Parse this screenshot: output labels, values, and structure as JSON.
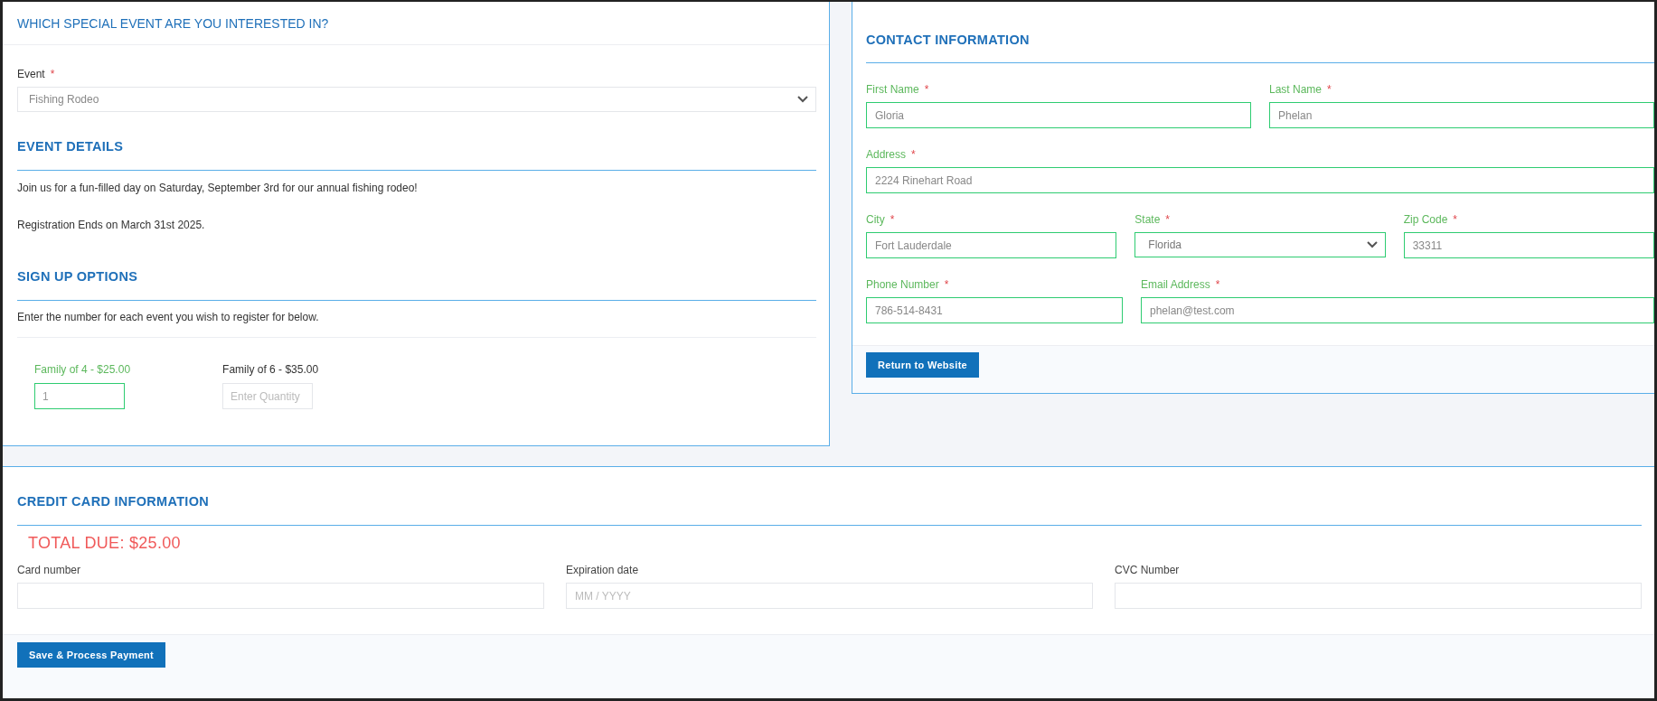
{
  "event_section": {
    "title": "WHICH SPECIAL EVENT ARE YOU INTERESTED IN?",
    "event_field": {
      "label": "Event",
      "required_mark": "*",
      "value": "Fishing Rodeo"
    }
  },
  "event_details": {
    "title": "EVENT DETAILS",
    "paragraphs": [
      "Join us for a fun-filled day on Saturday, September 3rd for our annual fishing rodeo!",
      "Registration Ends on March 31st 2025."
    ]
  },
  "signup_options": {
    "title": "SIGN UP OPTIONS",
    "instruction": "Enter the number for each event you wish to register for below.",
    "options": [
      {
        "label": "Family of 4 - $25.00",
        "value": "1",
        "valid": true
      },
      {
        "label": "Family of 6 - $35.00",
        "placeholder": "Enter Quantity",
        "valid": false
      }
    ]
  },
  "contact": {
    "title": "CONTACT INFORMATION",
    "rows": [
      [
        {
          "label": "First Name",
          "required_mark": "*",
          "kind": "text",
          "value": "Gloria",
          "valid": true
        },
        {
          "label": "Last Name",
          "required_mark": "*",
          "kind": "text",
          "value": "Phelan",
          "valid": true
        }
      ],
      [
        {
          "label": "Address",
          "required_mark": "*",
          "kind": "text",
          "value": "2224 Rinehart Road",
          "valid": true
        }
      ],
      [
        {
          "label": "City",
          "required_mark": "*",
          "kind": "text",
          "value": "Fort Lauderdale",
          "valid": true
        },
        {
          "label": "State",
          "required_mark": "*",
          "kind": "select",
          "value": "Florida",
          "valid": true
        },
        {
          "label": "Zip Code",
          "required_mark": "*",
          "kind": "text",
          "value": "33311",
          "valid": true
        }
      ],
      [
        {
          "label": "Phone Number",
          "required_mark": "*",
          "kind": "text",
          "value": "786-514-8431",
          "valid": true
        },
        {
          "label": "Email Address",
          "required_mark": "*",
          "kind": "text",
          "value": "phelan@test.com",
          "valid": true
        }
      ]
    ],
    "button": "Return to Website"
  },
  "credit_card": {
    "title": "CREDIT CARD INFORMATION",
    "total_due": "TOTAL DUE: $25.00",
    "fields": [
      {
        "label": "Card number"
      },
      {
        "label": "Expiration date",
        "placeholder": "MM / YYYY"
      },
      {
        "label": "CVC Number"
      }
    ],
    "button": "Save & Process Payment"
  }
}
